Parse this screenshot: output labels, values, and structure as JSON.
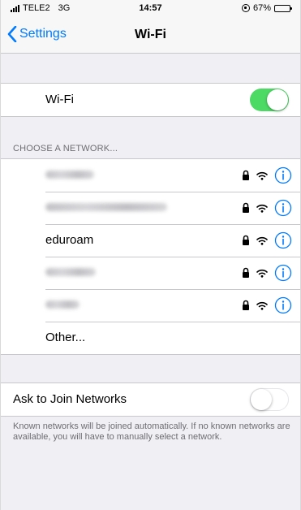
{
  "status_bar": {
    "carrier": "TELE2",
    "network_type": "3G",
    "time": "14:57",
    "battery": "67%",
    "battery_level": 0.67
  },
  "nav": {
    "back_label": "Settings",
    "title": "Wi-Fi"
  },
  "wifi_row": {
    "label": "Wi-Fi",
    "enabled": true,
    "toggle_color": "#4cd964"
  },
  "choose_network": {
    "header": "CHOOSE A NETWORK...",
    "networks": [
      {
        "name": "",
        "obscured": true,
        "secured": true
      },
      {
        "name": "",
        "obscured": true,
        "secured": true
      },
      {
        "name": "eduroam",
        "obscured": false,
        "secured": true
      },
      {
        "name": "",
        "obscured": true,
        "secured": true
      },
      {
        "name": "",
        "obscured": true,
        "secured": true
      }
    ],
    "other_label": "Other..."
  },
  "ask_to_join": {
    "label": "Ask to Join Networks",
    "enabled": false,
    "footer": "Known networks will be joined automatically. If no known networks are available, you will have to manually select a network."
  },
  "colors": {
    "accent": "#007aff",
    "background": "#efeff4"
  },
  "icons": [
    "signal-icon",
    "orientation-lock-icon",
    "battery-icon",
    "chevron-left-icon",
    "lock-icon",
    "wifi-icon",
    "info-icon"
  ]
}
